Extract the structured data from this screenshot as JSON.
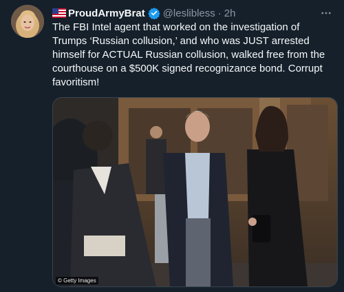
{
  "tweet": {
    "flag_icon": "us-flag-icon",
    "display_name": "ProudArmyBrat",
    "verified_icon": "verified-badge-icon",
    "handle": "@leslibless",
    "separator": "·",
    "time": "2h",
    "more_icon": "more-options-icon",
    "text": "The FBI Intel agent that worked on the investigation of Trumps ‘Russian collusion,’ and who was JUST arrested himself for ACTUAL Russian collusion, walked free from the courthouse on a $500K signed recognizance bond. Corrupt favoritism!",
    "media": {
      "credit": "© Getty Images"
    }
  },
  "colors": {
    "background": "#15202b",
    "text_primary": "#f7f9f9",
    "text_secondary": "#8b98a5",
    "verified": "#1d9bf0"
  }
}
